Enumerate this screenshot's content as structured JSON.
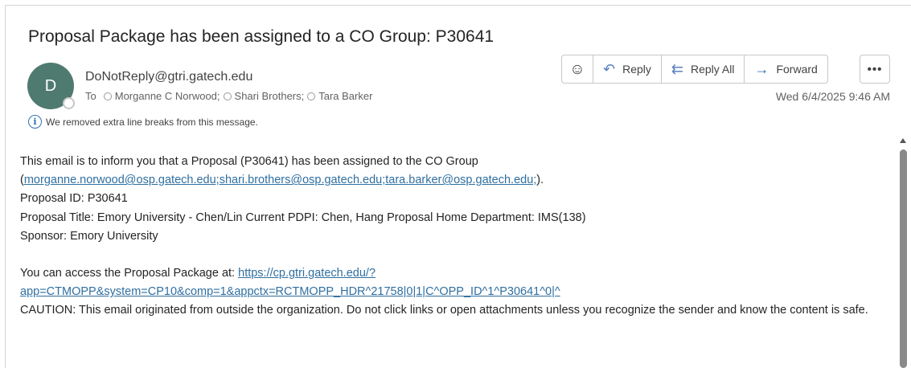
{
  "message": {
    "subject": "Proposal Package has been assigned to a CO Group: P30641",
    "avatar_initial": "D",
    "sender": "DoNotReply@gtri.gatech.edu",
    "to_label": "To",
    "recipients": [
      "Morganne C Norwood;",
      "Shari Brothers;",
      "Tara Barker"
    ],
    "date": "Wed 6/4/2025 9:46 AM",
    "info_text": "We removed extra line breaks from this message."
  },
  "actions": {
    "emoji_icon": "smiley-icon",
    "reply_label": "Reply",
    "reply_all_label": "Reply All",
    "forward_label": "Forward",
    "more_label": "•••"
  },
  "body": {
    "line1": "This email is to inform you that a Proposal (P30641) has been assigned to the CO Group",
    "line2_prefix": "(",
    "line2_link": "morganne.norwood@osp.gatech.edu;shari.brothers@osp.gatech.edu;tara.barker@osp.gatech.edu;",
    "line2_suffix": ").",
    "proposal_id": "Proposal ID: P30641",
    "proposal_title": "Proposal Title: Emory University - Chen/Lin Current PDPI: Chen, Hang Proposal Home Department: IMS(138)",
    "sponsor": "Sponsor: Emory University",
    "access_prefix": "You can access the Proposal Package at: ",
    "access_link_1": "https://cp.gtri.gatech.edu/?",
    "access_link_2": "app=CTMOPP&system=CP10&comp=1&appctx=RCTMOPP_HDR^21758|0|1|C^OPP_ID^1^P30641^0|^",
    "caution": "CAUTION: This email originated from outside the organization. Do not click links or open attachments unless you recognize the sender and know the content is safe."
  }
}
